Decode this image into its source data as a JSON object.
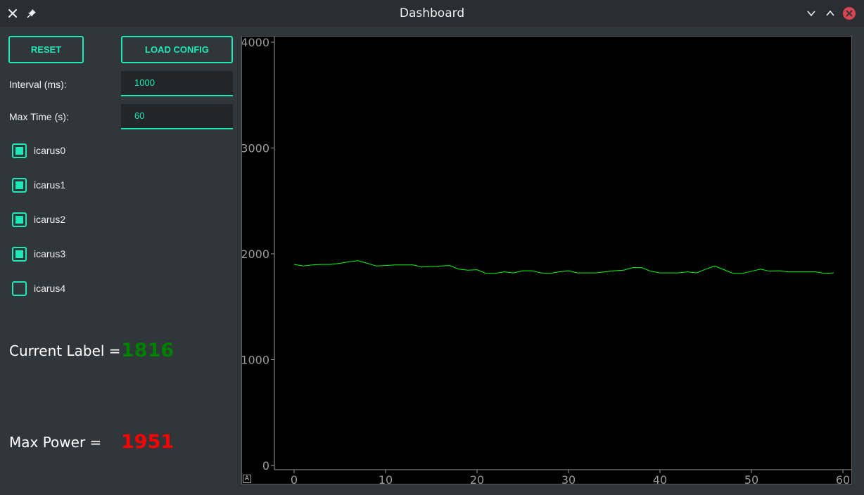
{
  "window": {
    "title": "Dashboard"
  },
  "icons": {
    "left_close": "close-icon",
    "pin": "pin-icon",
    "minimize": "chevron-down-icon",
    "maximize": "chevron-up-icon",
    "close": "close-circle-icon"
  },
  "toolbar": {
    "reset_label": "RESET",
    "load_config_label": "LOAD CONFIG"
  },
  "settings": {
    "interval_label": "Interval (ms):",
    "interval_value": "1000",
    "max_time_label": "Max Time (s):",
    "max_time_value": "60"
  },
  "devices": [
    {
      "label": "icarus0",
      "checked": true
    },
    {
      "label": "icarus1",
      "checked": true
    },
    {
      "label": "icarus2",
      "checked": true
    },
    {
      "label": "icarus3",
      "checked": true
    },
    {
      "label": "icarus4",
      "checked": false
    }
  ],
  "readouts": {
    "current_label": "Current Label =",
    "current_value": "1816",
    "max_power_label": "Max Power =",
    "max_power_value": "1951"
  },
  "plot": {
    "auto_range_label": "A"
  },
  "colors": {
    "accent": "#1de9b6",
    "line": "#00ff00",
    "current": "#008000",
    "max": "#ff0000"
  },
  "chart_data": {
    "type": "line",
    "title": "",
    "xlabel": "",
    "ylabel": "",
    "xlim": [
      -5,
      60
    ],
    "ylim": [
      -50,
      4050
    ],
    "x_ticks": [
      0,
      10,
      20,
      30,
      40,
      50,
      60
    ],
    "y_ticks": [
      0,
      1000,
      2000,
      3000,
      4000
    ],
    "grid": false,
    "series": [
      {
        "color": "#00ff00",
        "x": [
          0,
          1,
          2,
          3,
          4,
          5,
          6,
          7,
          8,
          9,
          10,
          11,
          12,
          13,
          14,
          15,
          16,
          17,
          18,
          19,
          20,
          21,
          22,
          23,
          24,
          25,
          26,
          27,
          28,
          29,
          30,
          31,
          32,
          33,
          34,
          35,
          36,
          37,
          38,
          39,
          40,
          41,
          42,
          43,
          44,
          45,
          46,
          47,
          48,
          49,
          50,
          51,
          52,
          53,
          54,
          55,
          56,
          57,
          58,
          59
        ],
        "y": [
          1900,
          1885,
          1895,
          1900,
          1900,
          1910,
          1925,
          1935,
          1910,
          1885,
          1890,
          1895,
          1895,
          1895,
          1875,
          1880,
          1885,
          1890,
          1855,
          1845,
          1850,
          1815,
          1815,
          1830,
          1820,
          1840,
          1840,
          1820,
          1815,
          1830,
          1840,
          1820,
          1820,
          1820,
          1830,
          1840,
          1845,
          1870,
          1870,
          1835,
          1820,
          1820,
          1820,
          1830,
          1820,
          1855,
          1885,
          1850,
          1815,
          1815,
          1835,
          1855,
          1835,
          1840,
          1830,
          1830,
          1830,
          1830,
          1815,
          1820
        ]
      }
    ]
  }
}
